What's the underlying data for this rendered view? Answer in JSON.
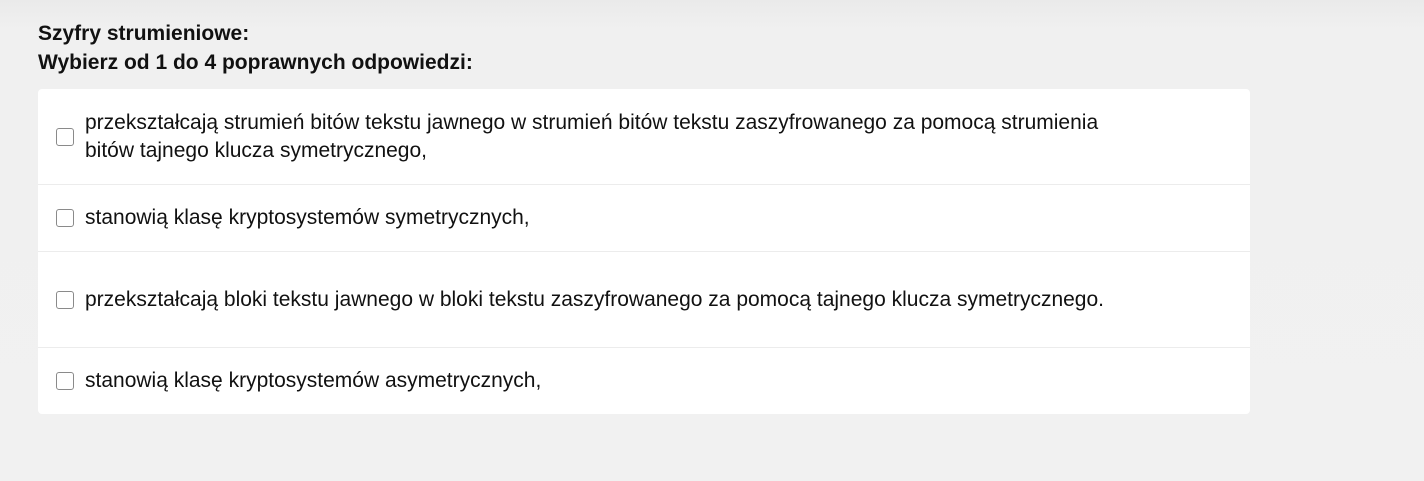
{
  "question": {
    "title": "Szyfry strumieniowe:",
    "instruction": "Wybierz od 1 do 4 poprawnych odpowiedzi:"
  },
  "answers": [
    {
      "text": "przekształcają strumień bitów tekstu jawnego w strumień bitów tekstu zaszyfrowanego za pomocą strumienia bitów tajnego klucza symetrycznego,",
      "checked": false
    },
    {
      "text": "stanowią klasę kryptosystemów symetrycznych,",
      "checked": false
    },
    {
      "text": "przekształcają bloki tekstu jawnego w bloki tekstu zaszyfrowanego za pomocą tajnego klucza symetrycznego.",
      "checked": false
    },
    {
      "text": "stanowią klasę kryptosystemów asymetrycznych,",
      "checked": false
    }
  ]
}
